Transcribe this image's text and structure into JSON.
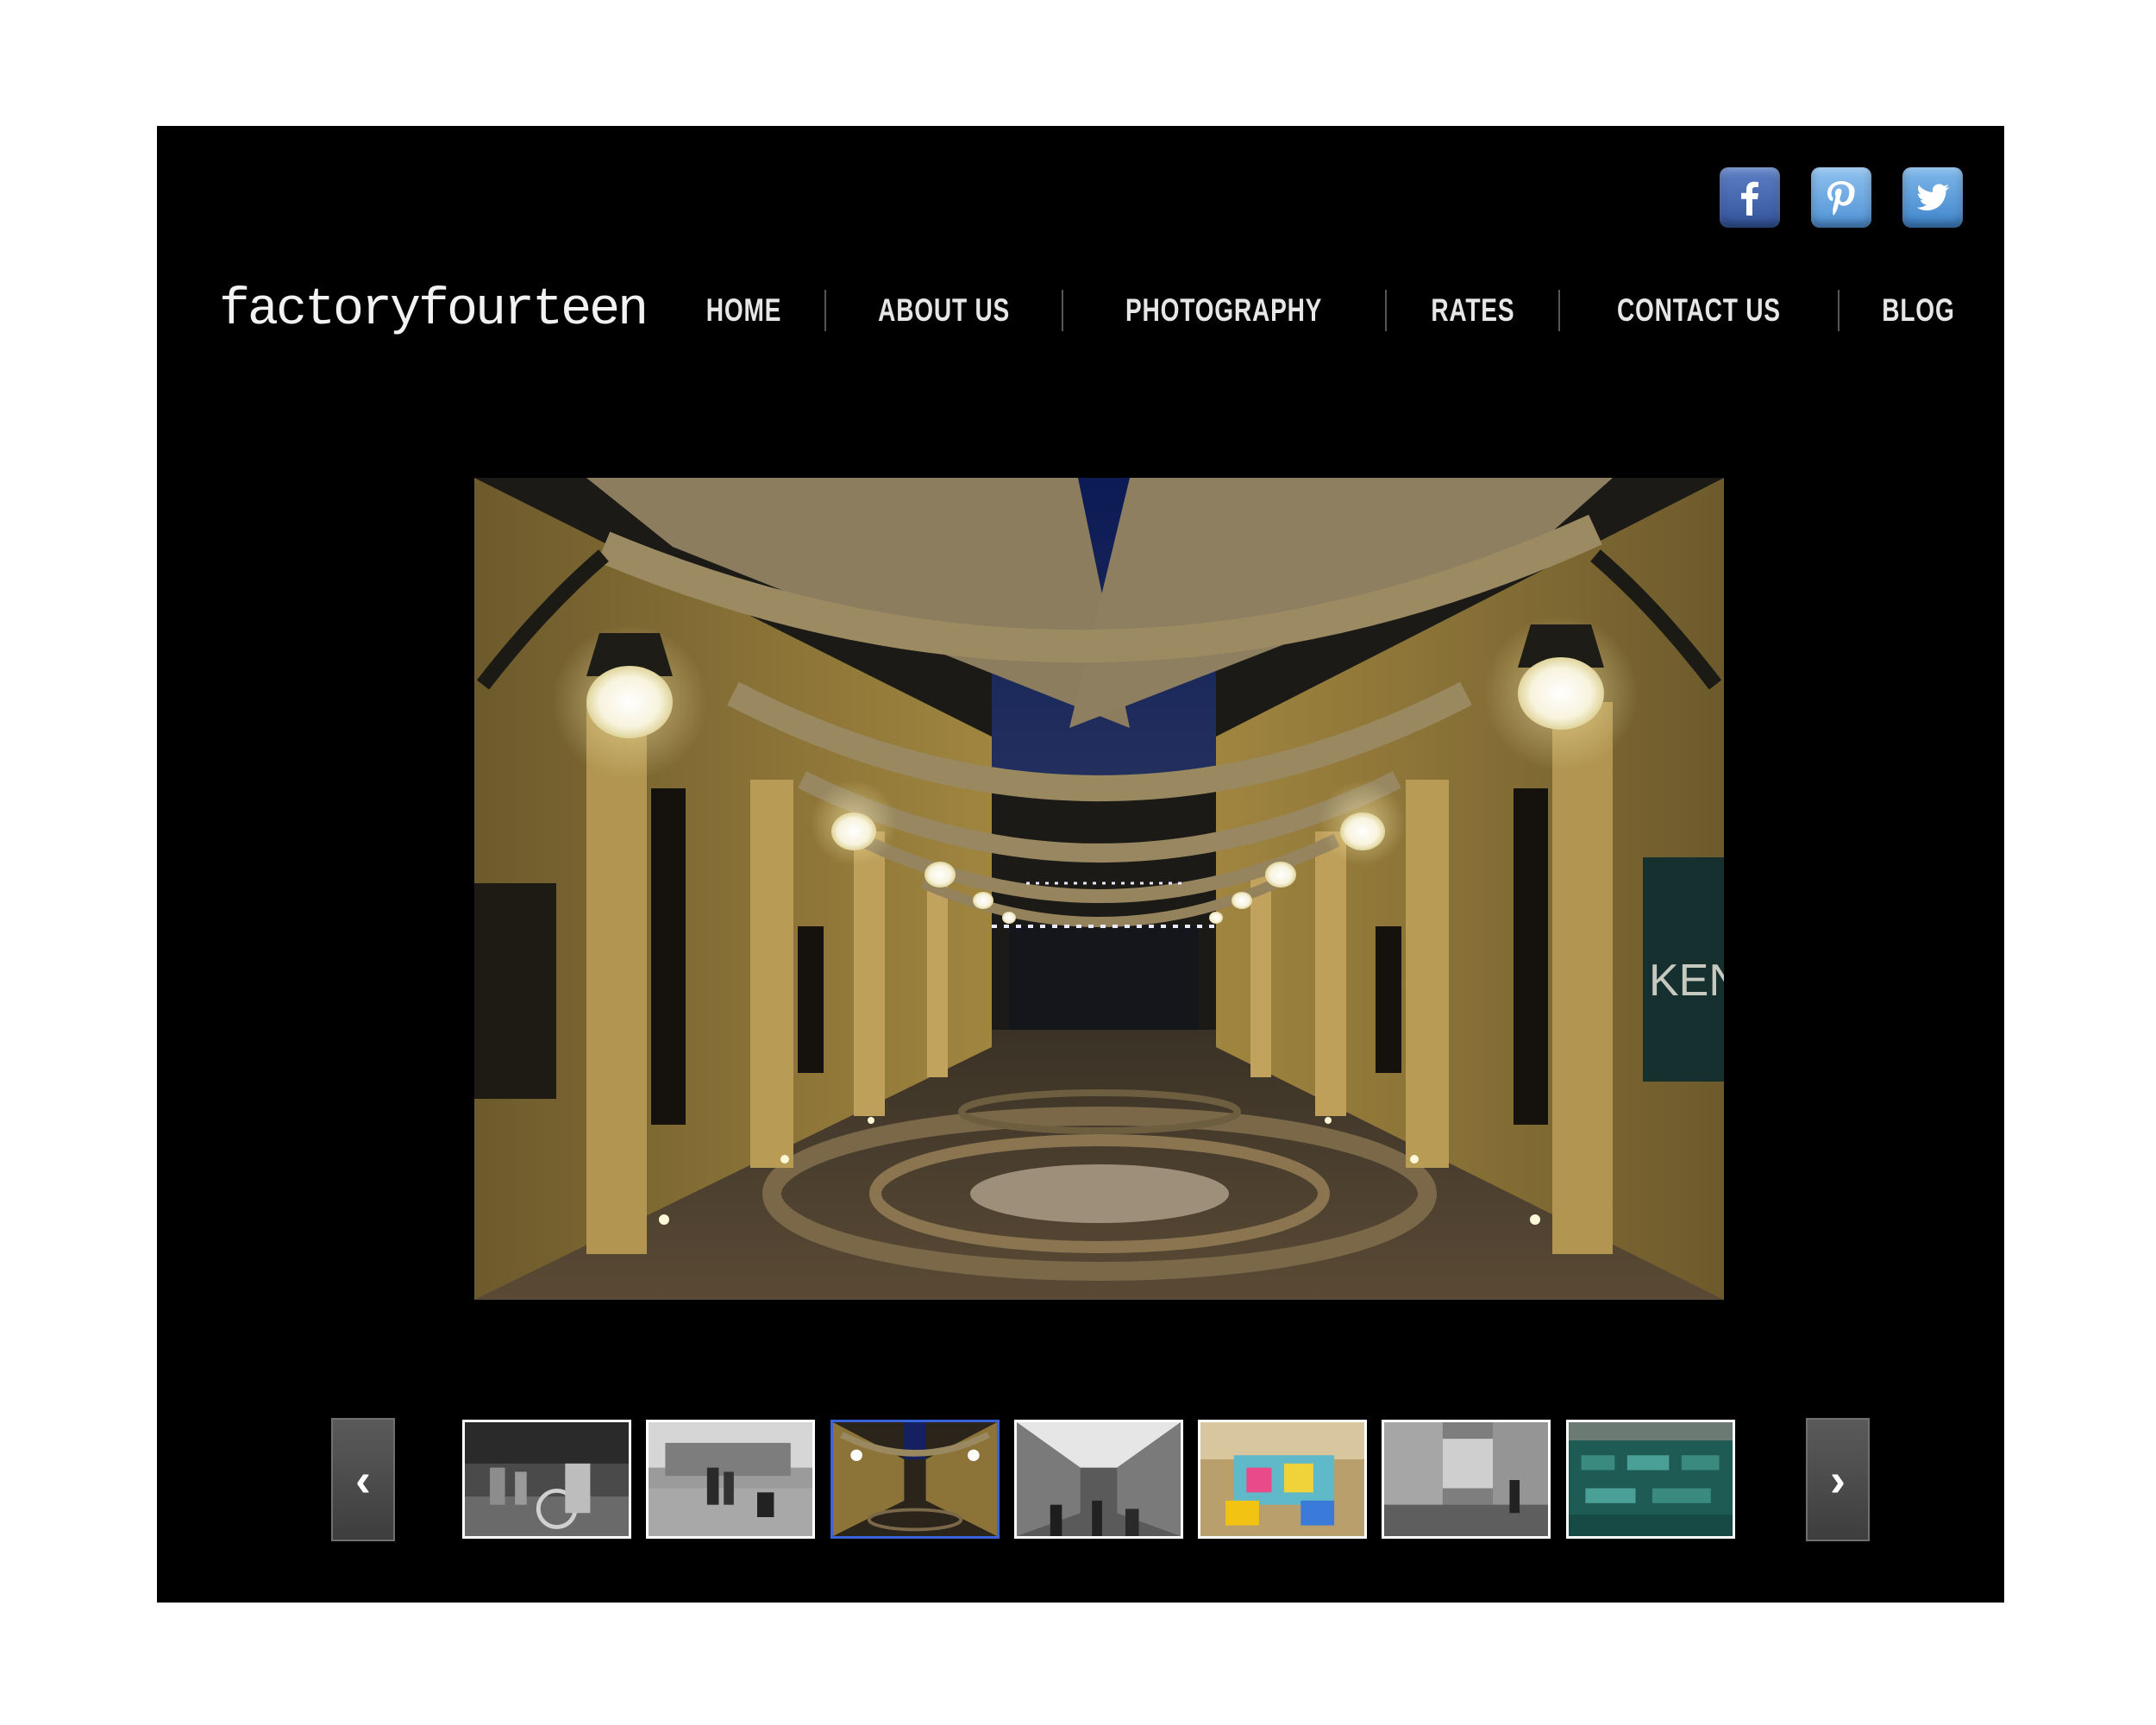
{
  "site": {
    "logo_text": "factoryfourteen"
  },
  "social": [
    {
      "name": "facebook",
      "icon": "facebook-icon"
    },
    {
      "name": "pinterest",
      "icon": "pinterest-icon"
    },
    {
      "name": "twitter",
      "icon": "twitter-icon"
    }
  ],
  "nav": {
    "home": "HOME",
    "about": "ABOUT US",
    "photography": "PHOTOGRAPHY",
    "rates": "RATES",
    "contact": "CONTACT US",
    "blog": "BLOG"
  },
  "hero": {
    "sign_text": "KEN"
  },
  "gallery": {
    "prev_icon": "chevron-left-icon",
    "next_icon": "chevron-right-icon",
    "prev_glyph": "‹",
    "next_glyph": "›",
    "active_index": 2,
    "active_color": "#3a63d8"
  }
}
